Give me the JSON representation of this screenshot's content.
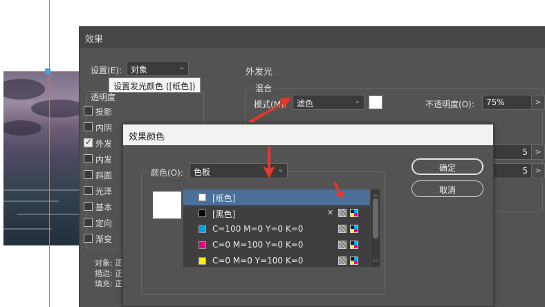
{
  "effects_dialog": {
    "title": "效果",
    "settings_label": "设置(E):",
    "settings_value": "对象",
    "transparency_label": "透明度",
    "effects": [
      {
        "label": "投影",
        "checked": false
      },
      {
        "label": "内阴",
        "checked": false
      },
      {
        "label": "外发",
        "checked": true
      },
      {
        "label": "内发",
        "checked": false
      },
      {
        "label": "斜面",
        "checked": false
      },
      {
        "label": "光泽",
        "checked": false
      },
      {
        "label": "基本",
        "checked": false
      },
      {
        "label": "定向",
        "checked": false
      },
      {
        "label": "渐变",
        "checked": false
      }
    ],
    "summary": [
      "对象: 正",
      "描边: 正",
      "填充: 正"
    ],
    "outer_glow_title": "外发光",
    "blend_group_label": "混合",
    "mode_label": "模式(M):",
    "mode_value": "滤色",
    "opacity_label": "不透明度(O):",
    "opacity_value": "75%",
    "partial_value_1": "5",
    "partial_value_2": "5",
    "stepper_glyph": ">",
    "tooltip": "设置发光颜色 ([纸色])"
  },
  "color_dialog": {
    "title": "效果颜色",
    "color_label": "颜色(O):",
    "color_value": "色板",
    "ok_button": "确定",
    "cancel_button": "取消",
    "swatches": [
      {
        "name": "[纸色]",
        "color": "#ffffff",
        "selected": true,
        "icons": []
      },
      {
        "name": "[黑色]",
        "color": "#000000",
        "selected": false,
        "icons": [
          "no-edit-icon",
          "process-color-icon",
          "cmyk-icon"
        ]
      },
      {
        "name": "C=100 M=0 Y=0 K=0",
        "color": "#00a0e0",
        "selected": false,
        "icons": [
          "process-color-icon",
          "cmyk-icon"
        ]
      },
      {
        "name": "C=0 M=100 Y=0 K=0",
        "color": "#e4007f",
        "selected": false,
        "icons": [
          "process-color-icon",
          "cmyk-icon"
        ]
      },
      {
        "name": "C=0 M=0 Y=100 K=0",
        "color": "#fff000",
        "selected": false,
        "icons": [
          "process-color-icon",
          "cmyk-icon"
        ]
      }
    ]
  },
  "colors": {
    "dialog_bg": "#535353",
    "selection": "#4a6f99",
    "guide": "#3aa6e8",
    "annotation_arrow": "#e8372c"
  },
  "icons": {
    "dropdown": "chevron-down-icon",
    "no_edit_glyph": "✕"
  }
}
